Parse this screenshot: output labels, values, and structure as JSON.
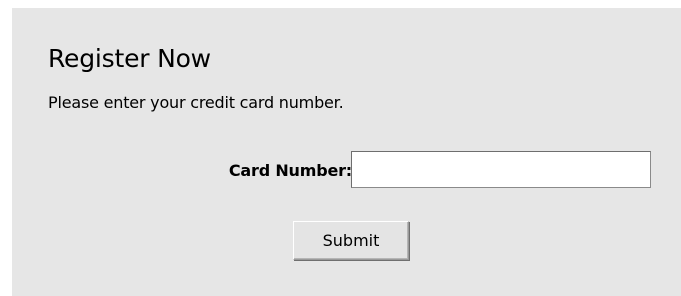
{
  "form": {
    "title": "Register Now",
    "instructions": "Please enter your credit card number.",
    "card_number_label": "Card Number:",
    "card_number_value": "",
    "card_number_placeholder": "",
    "submit_label": "Submit"
  },
  "colors": {
    "panel_background": "#e6e6e6",
    "page_background": "#ffffff",
    "input_background": "#ffffff"
  }
}
